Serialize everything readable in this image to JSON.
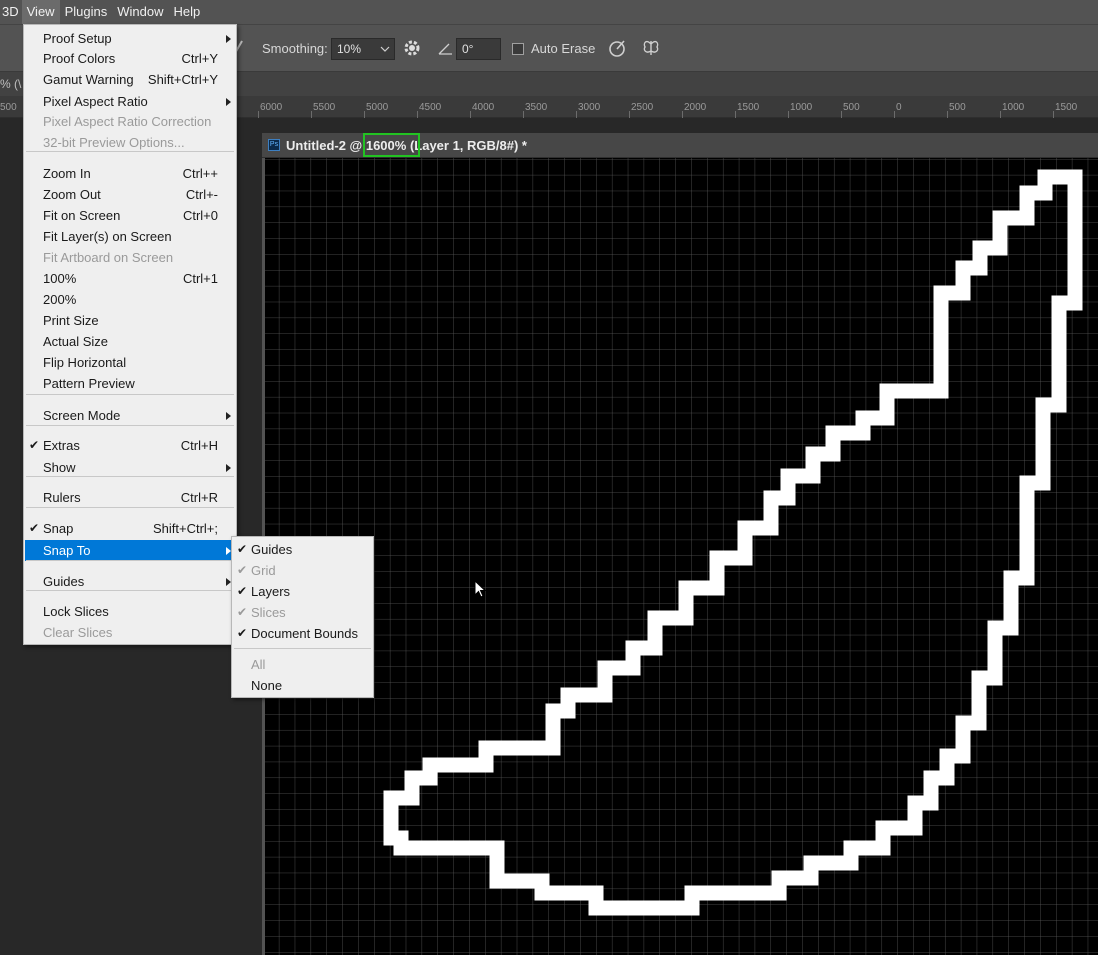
{
  "menubar": {
    "items": [
      "3D",
      "View",
      "Plugins",
      "Window",
      "Help"
    ]
  },
  "options": {
    "smoothing_label": "Smoothing:",
    "smoothing_value": "10%",
    "angle_value": "0°",
    "auto_erase_label": "Auto Erase"
  },
  "tabstrip": {
    "partial_tab": "% (\\"
  },
  "ruler": {
    "labels": [
      "500",
      "6000",
      "5500",
      "5000",
      "4500",
      "4000",
      "3500",
      "3000",
      "2500",
      "2000",
      "1500",
      "1000",
      "500",
      "0",
      "500",
      "1000",
      "1500"
    ]
  },
  "document": {
    "title_prefix": "Untitled-2 @ ",
    "zoom": "1600%",
    "title_suffix": " (Layer 1, RGB/8#) *",
    "ps_badge": "Ps"
  },
  "view_menu": {
    "items": [
      {
        "label": "Proof Setup",
        "shortcut": "",
        "submenu": true,
        "disabled": false,
        "checked": false
      },
      {
        "label": "Proof Colors",
        "shortcut": "Ctrl+Y",
        "submenu": false,
        "disabled": false,
        "checked": false
      },
      {
        "label": "Gamut Warning",
        "shortcut": "Shift+Ctrl+Y",
        "submenu": false,
        "disabled": false,
        "checked": false
      },
      {
        "label": "Pixel Aspect Ratio",
        "shortcut": "",
        "submenu": true,
        "disabled": false,
        "checked": false
      },
      {
        "label": "Pixel Aspect Ratio Correction",
        "shortcut": "",
        "submenu": false,
        "disabled": true,
        "checked": false
      },
      {
        "label": "32-bit Preview Options...",
        "shortcut": "",
        "submenu": false,
        "disabled": true,
        "checked": false
      },
      {
        "label": "Zoom In",
        "shortcut": "Ctrl++",
        "submenu": false,
        "disabled": false,
        "checked": false
      },
      {
        "label": "Zoom Out",
        "shortcut": "Ctrl+-",
        "submenu": false,
        "disabled": false,
        "checked": false
      },
      {
        "label": "Fit on Screen",
        "shortcut": "Ctrl+0",
        "submenu": false,
        "disabled": false,
        "checked": false
      },
      {
        "label": "Fit Layer(s) on Screen",
        "shortcut": "",
        "submenu": false,
        "disabled": false,
        "checked": false
      },
      {
        "label": "Fit Artboard on Screen",
        "shortcut": "",
        "submenu": false,
        "disabled": true,
        "checked": false
      },
      {
        "label": "100%",
        "shortcut": "Ctrl+1",
        "submenu": false,
        "disabled": false,
        "checked": false
      },
      {
        "label": "200%",
        "shortcut": "",
        "submenu": false,
        "disabled": false,
        "checked": false
      },
      {
        "label": "Print Size",
        "shortcut": "",
        "submenu": false,
        "disabled": false,
        "checked": false
      },
      {
        "label": "Actual Size",
        "shortcut": "",
        "submenu": false,
        "disabled": false,
        "checked": false
      },
      {
        "label": "Flip Horizontal",
        "shortcut": "",
        "submenu": false,
        "disabled": false,
        "checked": false
      },
      {
        "label": "Pattern Preview",
        "shortcut": "",
        "submenu": false,
        "disabled": false,
        "checked": false
      },
      {
        "label": "Screen Mode",
        "shortcut": "",
        "submenu": true,
        "disabled": false,
        "checked": false
      },
      {
        "label": "Extras",
        "shortcut": "Ctrl+H",
        "submenu": false,
        "disabled": false,
        "checked": true
      },
      {
        "label": "Show",
        "shortcut": "",
        "submenu": true,
        "disabled": false,
        "checked": false
      },
      {
        "label": "Rulers",
        "shortcut": "Ctrl+R",
        "submenu": false,
        "disabled": false,
        "checked": false
      },
      {
        "label": "Snap",
        "shortcut": "Shift+Ctrl+;",
        "submenu": false,
        "disabled": false,
        "checked": true
      },
      {
        "label": "Snap To",
        "shortcut": "",
        "submenu": true,
        "disabled": false,
        "checked": false,
        "highlighted": true
      },
      {
        "label": "Guides",
        "shortcut": "",
        "submenu": true,
        "disabled": false,
        "checked": false
      },
      {
        "label": "Lock Slices",
        "shortcut": "",
        "submenu": false,
        "disabled": false,
        "checked": false
      },
      {
        "label": "Clear Slices",
        "shortcut": "",
        "submenu": false,
        "disabled": true,
        "checked": false
      }
    ]
  },
  "snap_menu": {
    "items": [
      {
        "label": "Guides",
        "checked": true,
        "disabled": false
      },
      {
        "label": "Grid",
        "checked": true,
        "disabled": true
      },
      {
        "label": "Layers",
        "checked": true,
        "disabled": false
      },
      {
        "label": "Slices",
        "checked": true,
        "disabled": true
      },
      {
        "label": "Document Bounds",
        "checked": true,
        "disabled": false
      },
      {
        "label": "All",
        "checked": false,
        "disabled": true
      },
      {
        "label": "None",
        "checked": false,
        "disabled": false
      }
    ]
  },
  "checkmark": "✔",
  "colors": {
    "menu_highlight": "#0078d7",
    "zoom_box": "#22c322",
    "stroke": "#ffffff",
    "canvas": "#000000"
  }
}
